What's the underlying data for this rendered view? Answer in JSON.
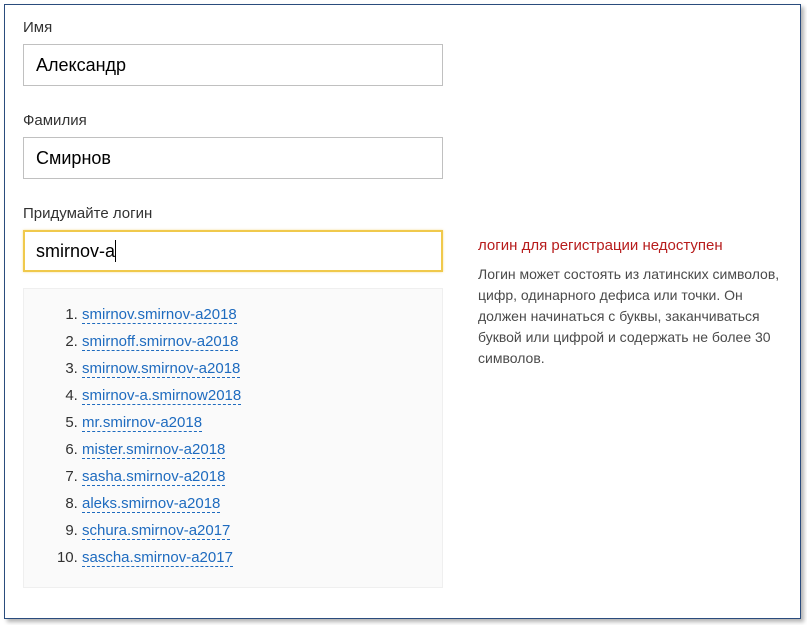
{
  "form": {
    "firstName": {
      "label": "Имя",
      "value": "Александр"
    },
    "lastName": {
      "label": "Фамилия",
      "value": "Смирнов"
    },
    "login": {
      "label": "Придумайте логин",
      "value": "smirnov-a"
    }
  },
  "suggestions": [
    "smirnov.smirnov-a2018",
    "smirnoff.smirnov-a2018",
    "smirnow.smirnov-a2018",
    "smirnov-a.smirnow2018",
    "mr.smirnov-a2018",
    "mister.smirnov-a2018",
    "sasha.smirnov-a2018",
    "aleks.smirnov-a2018",
    "schura.smirnov-a2017",
    "sascha.smirnov-a2017"
  ],
  "validation": {
    "errorTitle": "логин для регистрации недоступен",
    "hint": "Логин может состоять из латинских символов, цифр, одинарного дефиса или точки. Он должен начинаться с буквы, заканчиваться буквой или цифрой и содержать не более 30 символов."
  }
}
